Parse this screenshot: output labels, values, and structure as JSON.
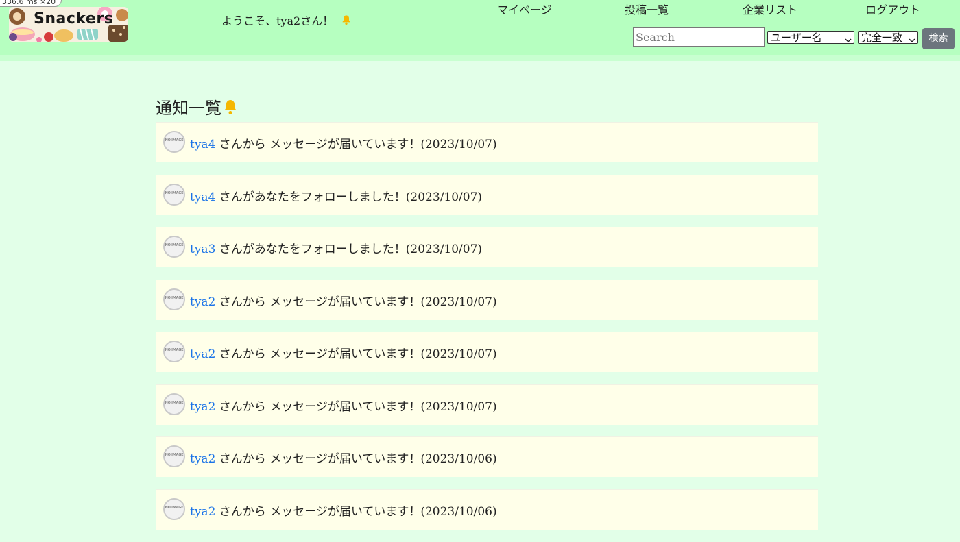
{
  "timer": "336.6 ms  ×20",
  "logo": {
    "text": "Snackers",
    "icon": "snackers-logo"
  },
  "header": {
    "welcome": "ようこそ、tya2さん！",
    "welcome_icon": "bell-icon",
    "nav": [
      {
        "label": "マイページ"
      },
      {
        "label": "投稿一覧"
      },
      {
        "label": "企業リスト"
      },
      {
        "label": "ログアウト"
      }
    ],
    "search": {
      "placeholder": "Search",
      "value": "",
      "field_select": "ユーザー名",
      "match_select": "完全一致",
      "button_label": "検索"
    }
  },
  "main": {
    "title": "通知一覧",
    "title_icon": "bell-icon",
    "avatar_placeholder": "NO IMAGE",
    "notifications": [
      {
        "user": "tya4",
        "text": "さんから メッセージが届いています！(2023/10/07)"
      },
      {
        "user": "tya4",
        "text": "さんがあなたをフォローしました！(2023/10/07)"
      },
      {
        "user": "tya3",
        "text": "さんがあなたをフォローしました！(2023/10/07)"
      },
      {
        "user": "tya2",
        "text": "さんから メッセージが届いています！(2023/10/07)"
      },
      {
        "user": "tya2",
        "text": "さんから メッセージが届いています！(2023/10/07)"
      },
      {
        "user": "tya2",
        "text": "さんから メッセージが届いています！(2023/10/07)"
      },
      {
        "user": "tya2",
        "text": "さんから メッセージが届いています！(2023/10/06)"
      },
      {
        "user": "tya2",
        "text": "さんから メッセージが届いています！(2023/10/06)"
      }
    ]
  },
  "colors": {
    "header_bg": "#b6ffc0",
    "page_bg": "#e2ffe8",
    "card_bg": "#ffffe9",
    "link": "#1a73e8",
    "bell": "#f5b800",
    "button": "#6c757d"
  }
}
